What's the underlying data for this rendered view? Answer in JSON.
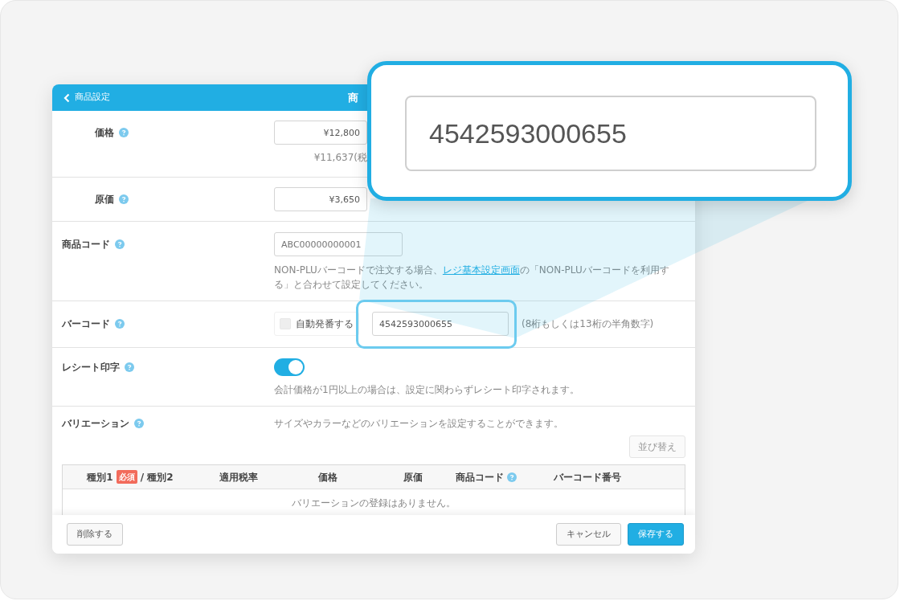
{
  "window": {
    "back_label": "商品設定",
    "title": "商"
  },
  "fields": [
    {
      "kind": "price",
      "label": "価格",
      "help": true,
      "value": "¥12,800",
      "note": "¥11,637(税"
    },
    {
      "kind": "price",
      "label": "原価",
      "help": true,
      "value": "¥3,650"
    },
    {
      "kind": "code",
      "label": "商品コード",
      "help": true,
      "placeholder": "ABC00000000001",
      "help_before": "NON-PLUバーコードで注文する場合、",
      "help_link": "レジ基本設定画面",
      "help_after": "の「NON-PLUバーコードを利用する」と合わせて設定してください。"
    },
    {
      "kind": "barcode",
      "label": "バーコード",
      "help": true,
      "checkbox": {
        "label": "自動発番する",
        "checked": false
      },
      "value": "4542593000655",
      "hint": "(8桁もしくは13桁の半角数字)"
    },
    {
      "kind": "toggle",
      "label": "レシート印字",
      "help": true,
      "on": true,
      "note": "会計価格が1円以上の場合は、設定に関わらずレシート印字されます。"
    },
    {
      "kind": "variations",
      "label": "バリエーション",
      "help": true,
      "description": "サイズやカラーなどのバリエーションを設定することができます。",
      "sort_button": {
        "label": "並び替え",
        "disabled": true
      },
      "columns": [
        {
          "label": "種別1",
          "badge": "必須",
          "label2": "/ 種別2"
        },
        {
          "label": "適用税率"
        },
        {
          "label": "価格"
        },
        {
          "label": "原価"
        },
        {
          "label": "商品コード",
          "help": true
        },
        {
          "label": "バーコード番号"
        }
      ],
      "empty_text": "バリエーションの登録はありません。"
    }
  ],
  "footer": {
    "delete": "削除する",
    "cancel": "キャンセル",
    "save": "保存する"
  },
  "magnifier": {
    "value": "4542593000655"
  }
}
